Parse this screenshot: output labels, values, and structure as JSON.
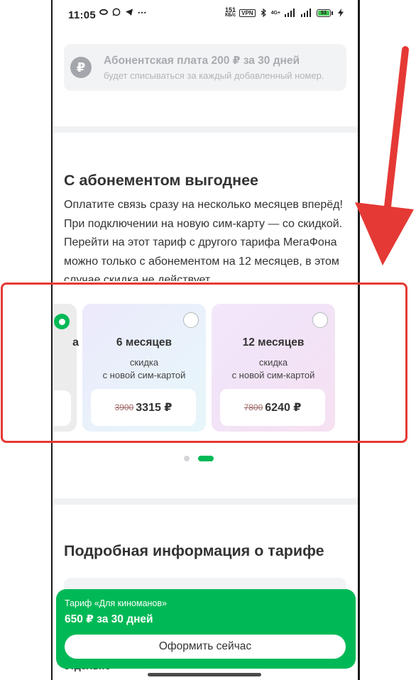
{
  "status_bar": {
    "time": "11:05",
    "net_speed_value": "151",
    "net_speed_unit": "КБ/с",
    "vpn": "VPN",
    "network": "4G+",
    "battery": "53",
    "icons": [
      "sync-icon",
      "whatsapp-icon",
      "telegram-icon",
      "more-icon",
      "bluetooth-icon",
      "signal-icon",
      "battery-icon",
      "charging-icon"
    ]
  },
  "fee_notice": {
    "icon": "ruble-icon",
    "symbol": "₽",
    "title": "Абонентская плата 200 ₽ за 30 дней",
    "subtitle": "будет списываться за каждый добавленный номер."
  },
  "subscription": {
    "title": "С абонементом выгоднее",
    "description": "Оплатите связь сразу на несколько месяцев вперёд! При подключении на новую сим-карту — со скидкой. Перейти на этот тариф с другого тарифа МегаФона можно только с абонементом на 12 месяцев, в этом случае скидка не действует.",
    "options": [
      {
        "label_fragment": "а",
        "selected": true
      },
      {
        "label": "6 месяцев",
        "discount_line1": "скидка",
        "discount_line2": "с новой сим-картой",
        "old_price": "3900",
        "new_price": "3315 ₽",
        "selected": false
      },
      {
        "label": "12 месяцев",
        "discount_line1": "скидка",
        "discount_line2": "с новой сим-картой",
        "old_price": "7800",
        "new_price": "6240 ₽",
        "selected": false
      }
    ],
    "pagination": {
      "pages": 2,
      "current": 2
    }
  },
  "details": {
    "title": "Подробная информация о тарифе",
    "hidden_text": "отдельно"
  },
  "bottom_bar": {
    "tariff_name": "Тариф «Для киноманов»",
    "price": "650 ₽ за 30 дней",
    "cta_label": "Оформить сейчас"
  },
  "colors": {
    "brand_green": "#00b956",
    "annotation_red": "#e53935"
  }
}
